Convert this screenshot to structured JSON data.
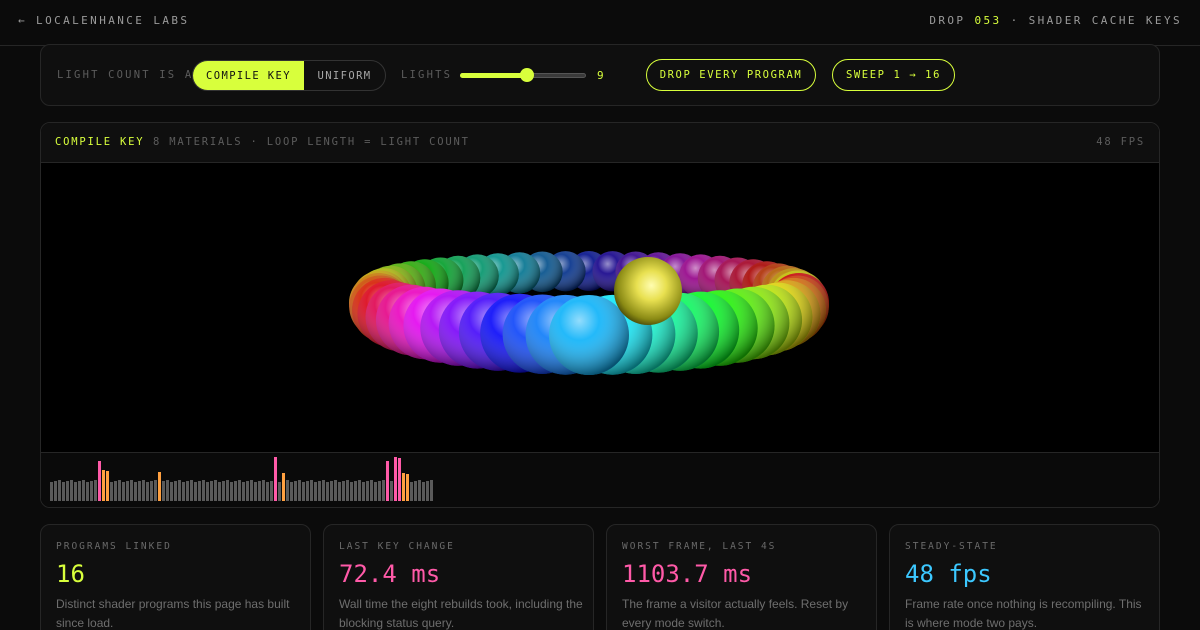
{
  "topbar": {
    "back_label": "← LOCALENHANCE LABS",
    "drop_prefix": "DROP",
    "drop_number": "053",
    "drop_suffix": "· SHADER CACHE KEYS"
  },
  "controls": {
    "mode_label": "LIGHT COUNT IS A",
    "mode_options": [
      "COMPILE KEY",
      "UNIFORM"
    ],
    "mode_selected": "COMPILE KEY",
    "lights_label": "LIGHTS",
    "lights_value": "9",
    "lights_min": 1,
    "lights_max": 16,
    "drop_button": "DROP EVERY PROGRAM",
    "sweep_button": "SWEEP 1 → 16"
  },
  "viewport": {
    "mode": "COMPILE KEY",
    "description": "8 MATERIALS · LOOP LENGTH = LIGHT COUNT",
    "fps": "48 FPS"
  },
  "stats": [
    {
      "label": "PROGRAMS LINKED",
      "value": "16",
      "color": "#d8ff3c",
      "note": "Distinct shader programs this page has built since load."
    },
    {
      "label": "LAST KEY CHANGE",
      "value": "72.4 ms",
      "color": "#ff5aa8",
      "note": "Wall time the eight rebuilds took, including the blocking status query."
    },
    {
      "label": "WORST FRAME, LAST 4S",
      "value": "1103.7 ms",
      "color": "#ff5aa8",
      "note": "The frame a visitor actually feels. Reset by every mode switch."
    },
    {
      "label": "STEADY-STATE",
      "value": "48 fps",
      "color": "#3cc8ff",
      "note": "Frame rate once nothing is recompiling. This is where mode two pays."
    }
  ],
  "colors": {
    "accent": "#d8ff3c",
    "spike": "#ff5aa8",
    "warn": "#ffa040",
    "normal_bar": "#5a5a5a"
  },
  "frame_bars": [
    "n",
    "n",
    "n",
    "n",
    "n",
    "n",
    "n",
    "n",
    "n",
    "n",
    "n",
    "n",
    "s",
    "w",
    "w",
    "n",
    "n",
    "n",
    "n",
    "n",
    "n",
    "n",
    "n",
    "n",
    "n",
    "n",
    "n",
    "w",
    "n",
    "n",
    "n",
    "n",
    "n",
    "n",
    "n",
    "n",
    "n",
    "n",
    "n",
    "n",
    "n",
    "n",
    "n",
    "n",
    "n",
    "n",
    "n",
    "n",
    "n",
    "n",
    "n",
    "n",
    "n",
    "n",
    "n",
    "n",
    "s",
    "n",
    "w",
    "n",
    "n",
    "n",
    "n",
    "n",
    "n",
    "n",
    "n",
    "n",
    "n",
    "n",
    "n",
    "n",
    "n",
    "n",
    "n",
    "n",
    "n",
    "n",
    "n",
    "n",
    "n",
    "n",
    "n",
    "n",
    "s",
    "n",
    "s",
    "s",
    "w",
    "w",
    "n",
    "n",
    "n",
    "n",
    "n",
    "n"
  ]
}
